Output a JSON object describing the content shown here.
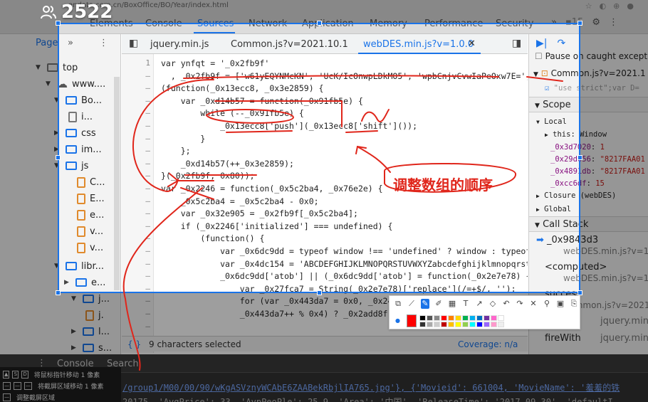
{
  "browser": {
    "url": "endata.com.cn/BoxOffice/BO/Year/index.html",
    "extension_count": "15"
  },
  "overlay": {
    "viewer_count": "2522"
  },
  "devtools_tabs": [
    "Elements",
    "Console",
    "Sources",
    "Network",
    "Application",
    "Memory",
    "Performance",
    "Security"
  ],
  "active_devtools_tab": "Sources",
  "navigator": {
    "tab_label": "Page",
    "tree": [
      {
        "label": "top"
      },
      {
        "label": "www...."
      },
      {
        "label": "Bo..."
      },
      {
        "label": "i..."
      },
      {
        "label": "css"
      },
      {
        "label": "im..."
      },
      {
        "label": "js"
      },
      {
        "label": "C..."
      },
      {
        "label": "E..."
      },
      {
        "label": "e..."
      },
      {
        "label": "v..."
      },
      {
        "label": "v..."
      },
      {
        "label": "libr..."
      },
      {
        "label": "e..."
      },
      {
        "label": "j..."
      },
      {
        "label": "j."
      },
      {
        "label": "l..."
      },
      {
        "label": "s..."
      }
    ]
  },
  "editor": {
    "tabs": [
      "jquery.min.js",
      "Common.js?v=2021.10.1",
      "webDES.min.js?v=1.0.0"
    ],
    "active_tab": "webDES.min.js?v=1.0.0",
    "line_numbers": [
      "1",
      "–",
      "–",
      "–",
      "–",
      "–",
      "–",
      "–",
      "–",
      "–",
      "–",
      "–",
      "–",
      "–",
      "–",
      "–",
      "–",
      "–",
      "–",
      "–",
      "–",
      "–"
    ],
    "code_lines": [
      "var ynfqt = '_0x2fb9f'",
      "  , _0x2fb9f = ['w61yEQYNMcKN', 'UcK/IcOnwpLDkMO5', 'wpbCnjvCvwIaPeOxw7E=', 'w",
      "(function(_0x13ecc8, _0x3e2859) {",
      "    var _0xd14b57 = function(_0x91fb5e) {",
      "        while (--_0x91fb5e) {",
      "            _0x13ecc8['push'](_0x13ecc8['shift']());",
      "        }",
      "    };",
      "    _0xd14b57(++_0x3e2859);",
      "}(_0x2fb9f, 0x80));",
      "var _0x2246 = function(_0x5c2ba4, _0x76e2e) {",
      "    _0x5c2ba4 = _0x5c2ba4 - 0x0;",
      "    var _0x32e905 = _0x2fb9f[_0x5c2ba4];",
      "    if (_0x2246['initialized'] === undefined) {",
      "        (function() {",
      "            var _0x6dc9dd = typeof window !== 'undefined' ? window : typeof pro",
      "            var _0x4dc154 = 'ABCDEFGHIJKLMNOPQRSTUVWXYZabcdefghijklmnopqrstuvwx",
      "            _0x6dc9dd['atob'] || (_0x6dc9dd['atob'] = function(_0x2e7e78) {",
      "                var _0x27fca7 = String(_0x2e7e78)['replace'](/=+$/, '');",
      "                for (var _0x443da7 = 0x0, _0x245",
      "                _0x443da7++ % 0x4) ? _0x2add8f +=",
      ""
    ],
    "status_selection": "9 characters selected",
    "status_coverage": "Coverage: n/a"
  },
  "debugger": {
    "pause_caught": "Pause on caught excepti",
    "breakpoint_file": "Common.js?v=2021.1",
    "breakpoint_code": "\"use strict\";var  D=",
    "scope_title": "Scope",
    "local_title": "Local",
    "this_row": "this: Window",
    "locals": [
      {
        "name": "_0x3d7020",
        "value": "1"
      },
      {
        "name": "_0x29d656",
        "value": "\"8217FAA01"
      },
      {
        "name": "_0x4891db",
        "value": "\"8217FAA01"
      },
      {
        "name": "_0xcc6df",
        "value": "15"
      }
    ],
    "closure_row": "Closure (webDES)",
    "global_row": "Global",
    "callstack_title": "Call Stack",
    "frames": [
      {
        "fn": "_0x9843d3",
        "loc": "webDES.min.js?v=1."
      },
      {
        "fn": "<computed>",
        "loc": "webDES.min.js?v=1."
      },
      {
        "fn": "success",
        "loc": "Common.js?v=2021.1"
      },
      {
        "fn": "i",
        "loc": "jquery.min.js"
      },
      {
        "fn": "fireWith",
        "loc": "jquery.min."
      }
    ]
  },
  "drawer": {
    "tabs": [
      "Console",
      "Search"
    ],
    "console_lines": [
      "/group1/M00/00/90/wKgASVznyWCAbE6ZAABekRbjlIA765.jpg'}, {'Movieid': 661004, 'MovieName': '羞羞的铁",
      "20175, 'AvgPrice': 33, 'AvpPeoPle': 25.9, 'Area': '中国', 'ReleaseTime': '2017.09.30', 'defaultI"
    ]
  },
  "hints": [
    {
      "keys": [
        "▲",
        "S",
        "D"
      ],
      "text": "将鼠标指针移动 1 像素"
    },
    {
      "keys": [
        "—",
        "—",
        "—"
      ],
      "text": "将截屏区域移动 1 像素"
    },
    {
      "keys": [
        "—"
      ],
      "text": "调整截屏区域"
    }
  ],
  "annotation": {
    "text": "调整数组的顺序",
    "color": "#e0261b"
  },
  "snip_colors": [
    "#000000",
    "#555555",
    "#888888",
    "#ff0000",
    "#ff7f00",
    "#ffd700",
    "#00b050",
    "#00b0f0",
    "#0070c0",
    "#7030a0",
    "#ff66cc",
    "#ffffff",
    "#333333",
    "#aaaaaa",
    "#cccccc",
    "#c00000",
    "#ffc000",
    "#ffff00",
    "#92d050",
    "#00ffff",
    "#0000ff",
    "#9966ff",
    "#ff99cc",
    "#eeeeee"
  ],
  "accent": "#1a73e8"
}
